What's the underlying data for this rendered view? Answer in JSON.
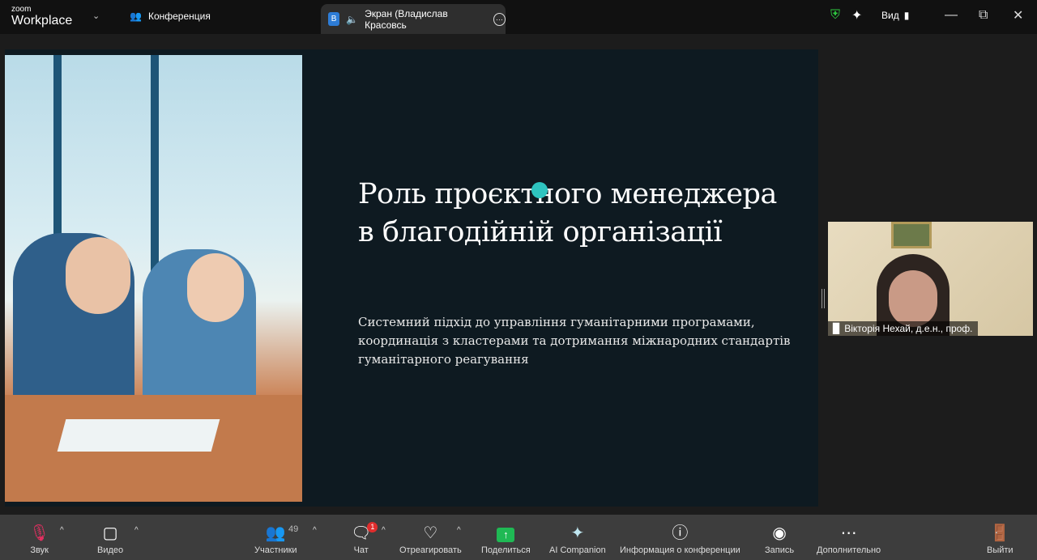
{
  "app": {
    "logo_small": "zoom",
    "logo_big": "Workplace",
    "meeting_label": "Конференция"
  },
  "tab": {
    "badge": "В",
    "label": "Экран (Владислав Красовсь"
  },
  "header": {
    "view_label": "Вид"
  },
  "slide": {
    "title": "Роль проєктного менеджера в благодійній організації",
    "subtitle": "Системний підхід до управління гуманітарними програмами, координація з кластерами та дотримання міжнародних стандартів гуманітарного реагування"
  },
  "participant": {
    "name": "Вікторія Нехай, д.е.н., проф."
  },
  "toolbar": {
    "audio": "Звук",
    "video": "Видео",
    "participants": "Участники",
    "participants_count": "49",
    "chat": "Чат",
    "chat_badge": "1",
    "react": "Отреагировать",
    "share": "Поделиться",
    "ai": "AI Companion",
    "info": "Информация о конференции",
    "record": "Запись",
    "more": "Дополнительно",
    "leave": "Выйти"
  },
  "colors": {
    "accent": "#2d7cd6",
    "share": "#1fb954",
    "danger": "#e02d2d"
  }
}
